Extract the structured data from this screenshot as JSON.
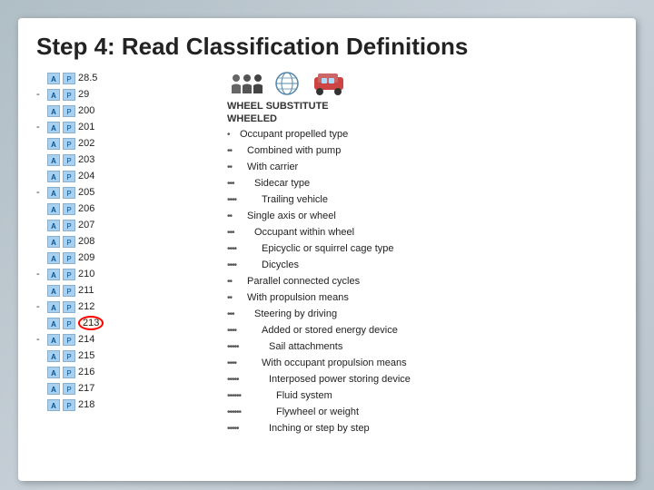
{
  "title": "Step 4: Read Classification Definitions",
  "left": {
    "rows": [
      {
        "dash": "",
        "num": "28.5",
        "circled": false
      },
      {
        "dash": "-",
        "num": "29",
        "circled": false
      },
      {
        "dash": "",
        "num": "200",
        "circled": false
      },
      {
        "dash": "-",
        "num": "201",
        "circled": false
      },
      {
        "dash": "",
        "num": "202",
        "circled": false
      },
      {
        "dash": "",
        "num": "203",
        "circled": false
      },
      {
        "dash": "",
        "num": "204",
        "circled": false
      },
      {
        "dash": "-",
        "num": "205",
        "circled": false
      },
      {
        "dash": "",
        "num": "206",
        "circled": false
      },
      {
        "dash": "",
        "num": "207",
        "circled": false
      },
      {
        "dash": "",
        "num": "208",
        "circled": false
      },
      {
        "dash": "",
        "num": "209",
        "circled": false
      },
      {
        "dash": "-",
        "num": "210",
        "circled": false
      },
      {
        "dash": "",
        "num": "211",
        "circled": false
      },
      {
        "dash": "-",
        "num": "212",
        "circled": false
      },
      {
        "dash": "",
        "num": "213",
        "circled": true
      },
      {
        "dash": "-",
        "num": "214",
        "circled": false
      },
      {
        "dash": "",
        "num": "215",
        "circled": false
      },
      {
        "dash": "",
        "num": "216",
        "circled": false
      },
      {
        "dash": "",
        "num": "217",
        "circled": false
      },
      {
        "dash": "",
        "num": "218",
        "circled": false
      }
    ]
  },
  "right": {
    "header1": "WHEEL SUBSTITUTE",
    "header2": "WHEELED",
    "entries": [
      {
        "dots": "•",
        "indent": 1,
        "text": "Occupant propelled type"
      },
      {
        "dots": "••",
        "indent": 2,
        "text": "Combined with pump"
      },
      {
        "dots": "••",
        "indent": 2,
        "text": "With carrier"
      },
      {
        "dots": "•••",
        "indent": 3,
        "text": "Sidecar type"
      },
      {
        "dots": "••••",
        "indent": 4,
        "text": "Trailing vehicle"
      },
      {
        "dots": "••",
        "indent": 2,
        "text": "Single axis or wheel"
      },
      {
        "dots": "•••",
        "indent": 3,
        "text": "Occupant within wheel"
      },
      {
        "dots": "••••",
        "indent": 4,
        "text": "Epicyclic or squirrel cage type"
      },
      {
        "dots": "••••",
        "indent": 4,
        "text": "Dicycles"
      },
      {
        "dots": "••",
        "indent": 2,
        "text": "Parallel connected cycles"
      },
      {
        "dots": "••",
        "indent": 2,
        "text": "With propulsion means"
      },
      {
        "dots": "•••",
        "indent": 3,
        "text": "Steering by driving"
      },
      {
        "dots": "••••",
        "indent": 4,
        "text": "Added or stored energy device"
      },
      {
        "dots": "•••••",
        "indent": 5,
        "text": "Sail attachments"
      },
      {
        "dots": "••••",
        "indent": 4,
        "text": "With occupant propulsion means"
      },
      {
        "dots": "•••••",
        "indent": 5,
        "text": "Interposed power storing device"
      },
      {
        "dots": "••••••",
        "indent": 6,
        "text": "Fluid system"
      },
      {
        "dots": "••••••",
        "indent": 6,
        "text": "Flywheel or weight"
      },
      {
        "dots": "•••••",
        "indent": 5,
        "text": "Inching or step by step"
      }
    ]
  }
}
